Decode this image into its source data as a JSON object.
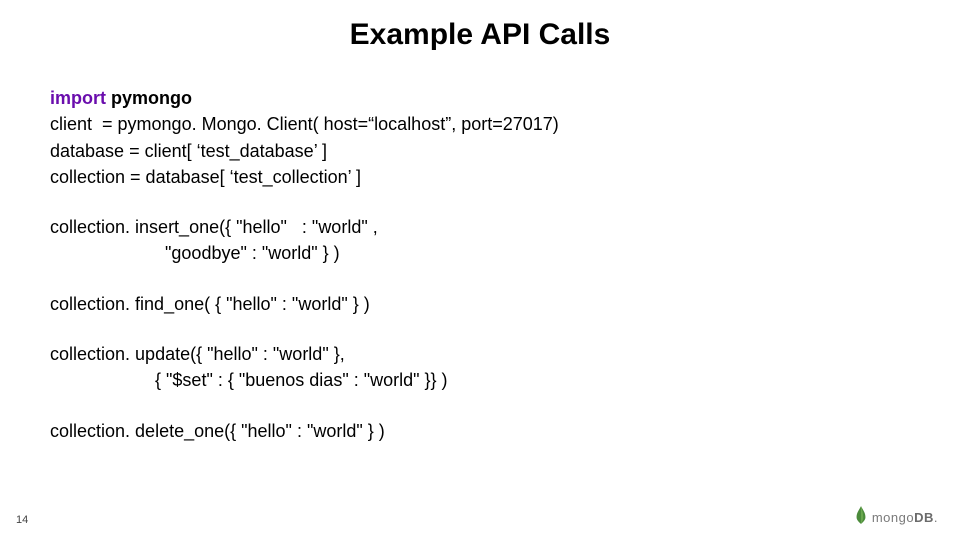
{
  "title": "Example API Calls",
  "code": {
    "l1_import": "import",
    "l1_module": " pymongo",
    "l2": "client  = pymongo. Mongo. Client( host=“localhost”, port=27017)",
    "l3": "database = client[ ‘test_database’ ]",
    "l4": "collection = database[ ‘test_collection’ ]",
    "l5": "collection. insert_one({ \"hello\"   : \"world\" ,",
    "l6": "                       \"goodbye\" : \"world\" } )",
    "l7": "collection. find_one( { \"hello\" : \"world\" } )",
    "l8": "collection. update({ \"hello\" : \"world\" },",
    "l9": "                     { \"$set\" : { \"buenos dias\" : \"world\" }} )",
    "l10": "collection. delete_one({ \"hello\" : \"world\" } )"
  },
  "page_number": "14",
  "logo": {
    "text_light": "mongo",
    "text_bold": "DB"
  }
}
